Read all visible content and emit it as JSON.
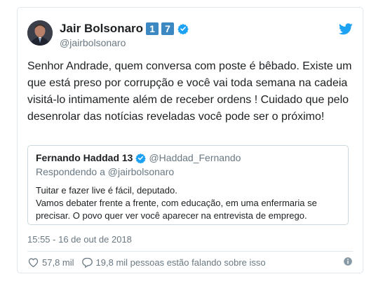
{
  "author": {
    "display_name": "Jair Bolsonaro",
    "emoji_digit_1": "1",
    "emoji_digit_2": "7",
    "handle": "@jairbolsonaro",
    "verified": true
  },
  "tweet": {
    "text": "Senhor Andrade, quem conversa com poste é bêbado. Existe um que está preso por corrupção e você vai toda semana na cadeia visitá-lo intimamente além de receber ordens ! Cuidado que pelo desenrolar das notícias reveladas você pode ser o próximo!",
    "timestamp": "15:55 - 16 de out de 2018"
  },
  "quoted_tweet": {
    "author_name": "Fernando Haddad 13",
    "author_handle": "@Haddad_Fernando",
    "reply_prefix": "Respondendo a",
    "reply_to": "@jairbolsonaro",
    "line1": "Tuitar e fazer live é fácil, deputado.",
    "line2": "Vamos debater frente a frente, com educação, em uma enfermaria se precisar. O povo quer ver você aparecer na entrevista de emprego."
  },
  "actions": {
    "likes": "57,8 mil",
    "conversation": "19,8 mil pessoas estão falando sobre isso"
  },
  "icons": {
    "brand": "twitter-bird-icon",
    "verified": "verified-badge-icon",
    "like": "heart-icon",
    "reply": "speech-bubble-icon",
    "info": "info-icon"
  },
  "colors": {
    "brand_blue": "#1da1f2",
    "emoji_blue": "#3b88c3",
    "muted": "#697882",
    "border": "#e1e8ed"
  }
}
